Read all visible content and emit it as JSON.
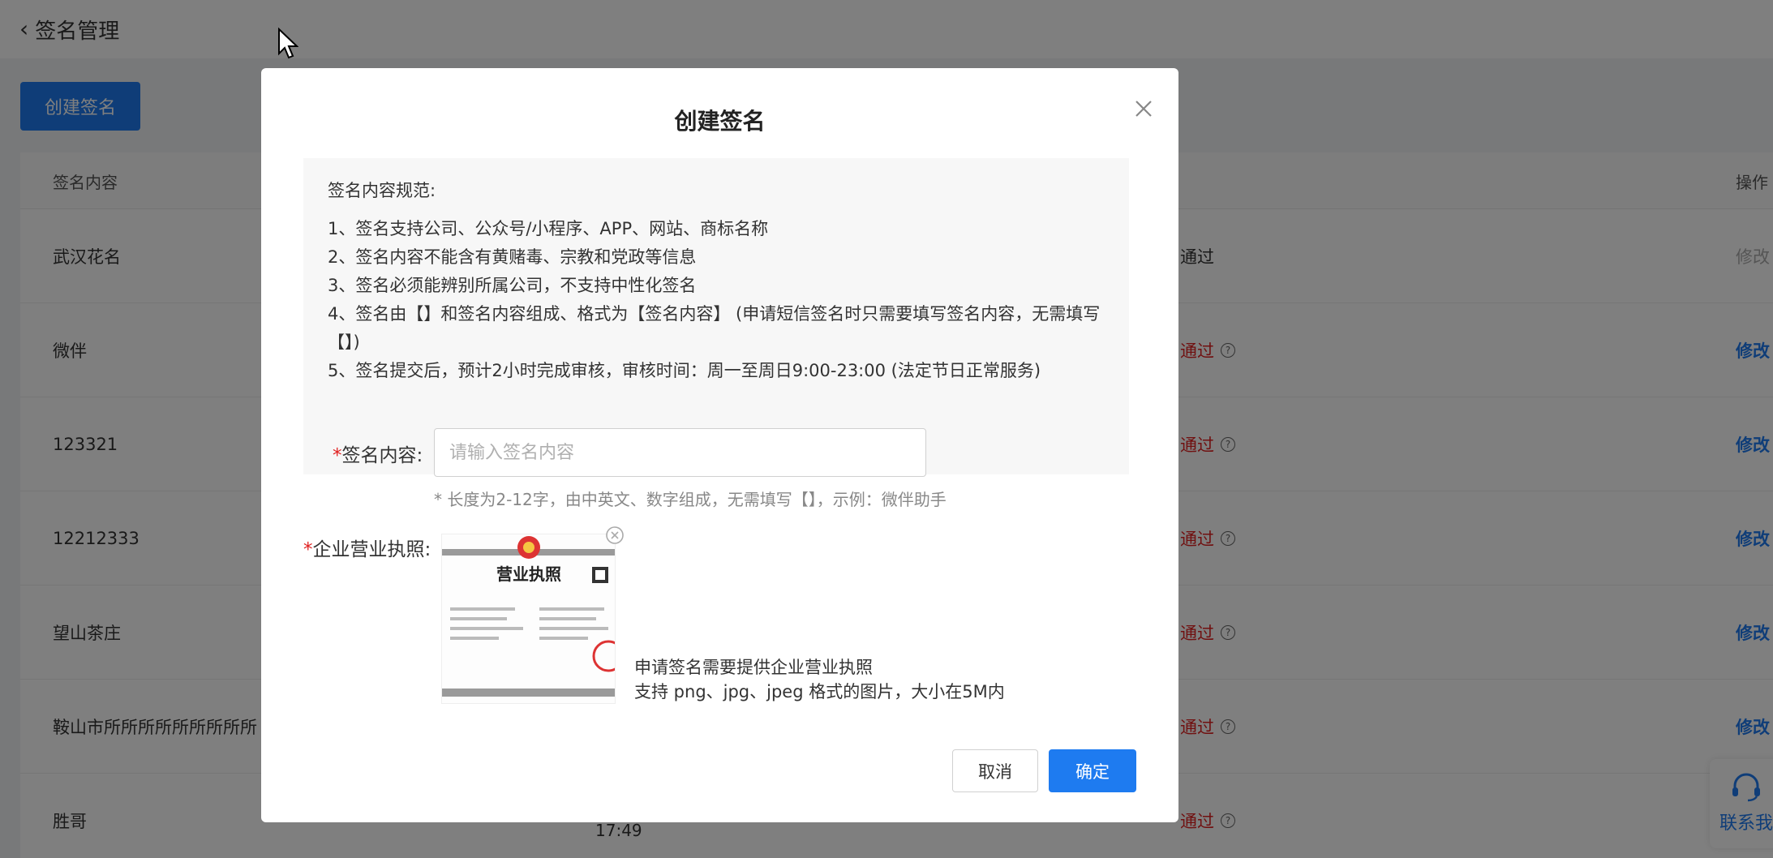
{
  "header": {
    "back_icon": "chevron-left-icon",
    "title": "签名管理"
  },
  "toolbar": {
    "create_label": "创建签名"
  },
  "table": {
    "col_content": "签名内容",
    "col_action": "操作",
    "rows": [
      {
        "content": "武汉花名",
        "status": "通过",
        "action": "修改"
      },
      {
        "content": "微伴",
        "status": "通过",
        "action": "修改"
      },
      {
        "content": "123321",
        "status": "通过",
        "action": "修改"
      },
      {
        "content": "12212333",
        "status": "通过",
        "action": "修改"
      },
      {
        "content": "望山茶庄",
        "status": "通过",
        "action": "修改"
      },
      {
        "content": "鞍山市所所所所所所所所所",
        "status": "通过",
        "action": "修改"
      },
      {
        "content": "胜哥",
        "status": "通过",
        "action": ""
      }
    ],
    "time_fragment": "17:49"
  },
  "contact": {
    "label": "联系我",
    "icon": "headset-icon"
  },
  "modal": {
    "title": "创建签名",
    "close_icon": "close-icon",
    "rules_title": "签名内容规范:",
    "rules": [
      "1、签名支持公司、公众号/小程序、APP、网站、商标名称",
      "2、签名内容不能含有黄赌毒、宗教和党政等信息",
      "3、签名必须能辨别所属公司，不支持中性化签名",
      "4、签名由【】和签名内容组成、格式为【签名内容】 (申请短信签名时只需要填写签名内容，无需填写【】)",
      "5、签名提交后，预计2小时完成审核，审核时间：周一至周日9:00-23:00 (法定节日正常服务)"
    ],
    "required_mark": "*",
    "content_label": "签名内容:",
    "content_placeholder": "请输入签名内容",
    "content_value": "",
    "content_hint": "* 长度为2-12字，由中英文、数字组成，无需填写【】，示例：微伴助手",
    "license_label": "企业营业执照:",
    "license_image_text": "营业执照",
    "license_note_1": "申请签名需要提供企业营业执照",
    "license_note_2": "支持 png、jpg、jpeg 格式的图片，大小在5M内",
    "cancel_label": "取消",
    "ok_label": "确定"
  }
}
